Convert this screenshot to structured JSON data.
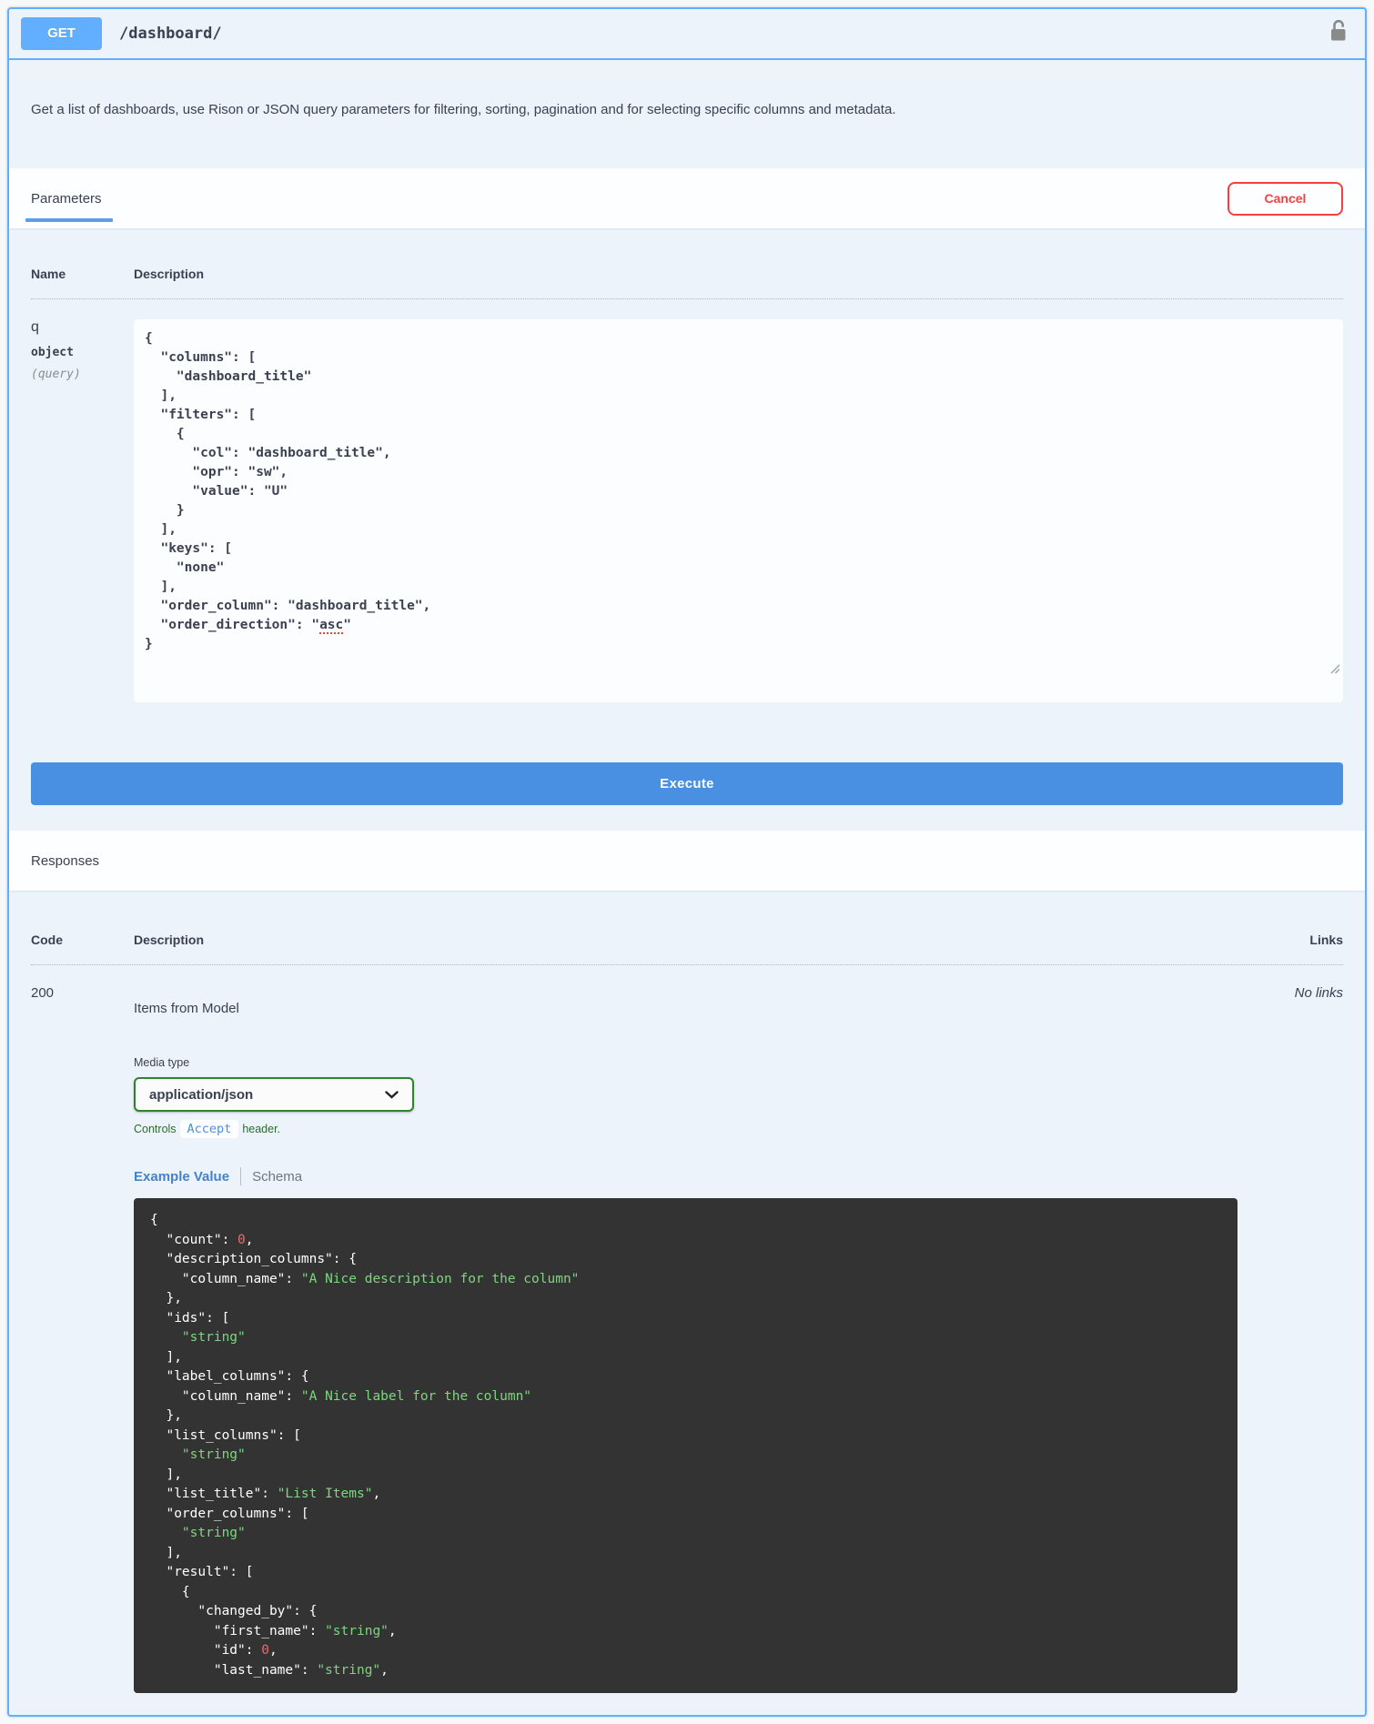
{
  "endpoint": {
    "method": "GET",
    "path": "/dashboard/",
    "description": "Get a list of dashboards, use Rison or JSON query parameters for filtering, sorting, pagination and for selecting specific columns and metadata."
  },
  "parameters_section": {
    "title": "Parameters",
    "cancel_label": "Cancel",
    "table": {
      "name_header": "Name",
      "description_header": "Description"
    },
    "param": {
      "name": "q",
      "type": "object",
      "location": "(query)",
      "value": "{\n  \"columns\": [\n    \"dashboard_title\"\n  ],\n  \"filters\": [\n    {\n      \"col\": \"dashboard_title\",\n      \"opr\": \"sw\",\n      \"value\": \"U\"\n    }\n  ],\n  \"keys\": [\n    \"none\"\n  ],\n  \"order_column\": \"dashboard_title\",\n  \"order_direction\": \"asc\"\n}",
      "misspelled_word": "asc"
    },
    "execute_label": "Execute"
  },
  "responses_section": {
    "title": "Responses",
    "table": {
      "code_header": "Code",
      "description_header": "Description",
      "links_header": "Links"
    },
    "response": {
      "code": "200",
      "description": "Items from Model",
      "links": "No links",
      "media_type_label": "Media type",
      "media_type_value": "application/json",
      "controls_prefix": "Controls",
      "controls_code": "Accept",
      "controls_suffix": "header.",
      "tabs": {
        "example": "Example Value",
        "schema": "Schema"
      },
      "example_json": "{\n  \"count\": 0,\n  \"description_columns\": {\n    \"column_name\": \"A Nice description for the column\"\n  },\n  \"ids\": [\n    \"string\"\n  ],\n  \"label_columns\": {\n    \"column_name\": \"A Nice label for the column\"\n  },\n  \"list_columns\": [\n    \"string\"\n  ],\n  \"list_title\": \"List Items\",\n  \"order_columns\": [\n    \"string\"\n  ],\n  \"result\": [\n    {\n      \"changed_by\": {\n        \"first_name\": \"string\",\n        \"id\": 0,\n        \"last_name\": \"string\","
    }
  },
  "icons": {
    "auth": "unlock-icon",
    "media_type_dropdown": "chevron-down-icon",
    "textarea_resize": "resize-grip-icon"
  },
  "colors": {
    "method_get": "#61affe",
    "block_background": "#ecf3fb",
    "execute_button": "#4990e2",
    "cancel_button": "#f93e3e",
    "media_select_border": "#2c852c",
    "code_block_background": "#333333",
    "code_string": "#7fd67f",
    "code_number": "#ea6b6b"
  }
}
